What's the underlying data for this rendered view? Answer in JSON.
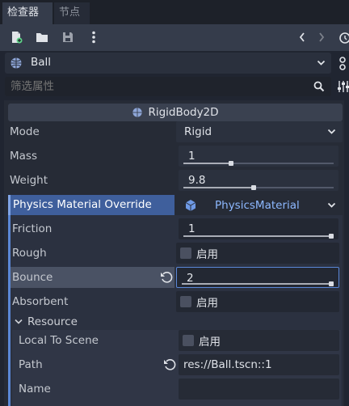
{
  "tabs": [
    {
      "label": "检查器",
      "active": true
    },
    {
      "label": "节点",
      "active": false
    }
  ],
  "toolbar": {
    "icons": [
      "new-resource-icon",
      "open-folder-icon",
      "save-icon",
      "more-vertical-icon"
    ],
    "nav_icons": [
      "chevron-left-icon",
      "chevron-right-icon"
    ]
  },
  "object": {
    "name": "Ball",
    "icon": "globe-icon"
  },
  "filter": {
    "placeholder": "筛选属性",
    "value": ""
  },
  "section": {
    "title": "RigidBody2D",
    "icon": "globe-icon"
  },
  "properties": {
    "mode": {
      "label": "Mode",
      "value": "Rigid"
    },
    "mass": {
      "label": "Mass",
      "value": "1",
      "slider_fraction": 0.3
    },
    "weight": {
      "label": "Weight",
      "value": "9.8",
      "slider_fraction": 0.45
    },
    "material_override": {
      "label": "Physics Material Override",
      "value": "PhysicsMaterial"
    }
  },
  "material": {
    "friction": {
      "label": "Friction",
      "value": "1",
      "slider_fraction": 1.0
    },
    "rough": {
      "label": "Rough",
      "check_label": "启用",
      "checked": false
    },
    "bounce": {
      "label": "Bounce",
      "value": "2",
      "slider_fraction": 1.0
    },
    "absorbent": {
      "label": "Absorbent",
      "check_label": "启用",
      "checked": false
    }
  },
  "resource": {
    "title": "Resource",
    "local_to_scene": {
      "label": "Local To Scene",
      "check_label": "启用",
      "checked": false
    },
    "path": {
      "label": "Path",
      "value": "res://Ball.tscn::1"
    },
    "name": {
      "label": "Name",
      "value": ""
    }
  },
  "colors": {
    "background": "#202531",
    "accent": "#5a87d6",
    "text": "#cdd0d6",
    "link": "#8db8ff"
  }
}
